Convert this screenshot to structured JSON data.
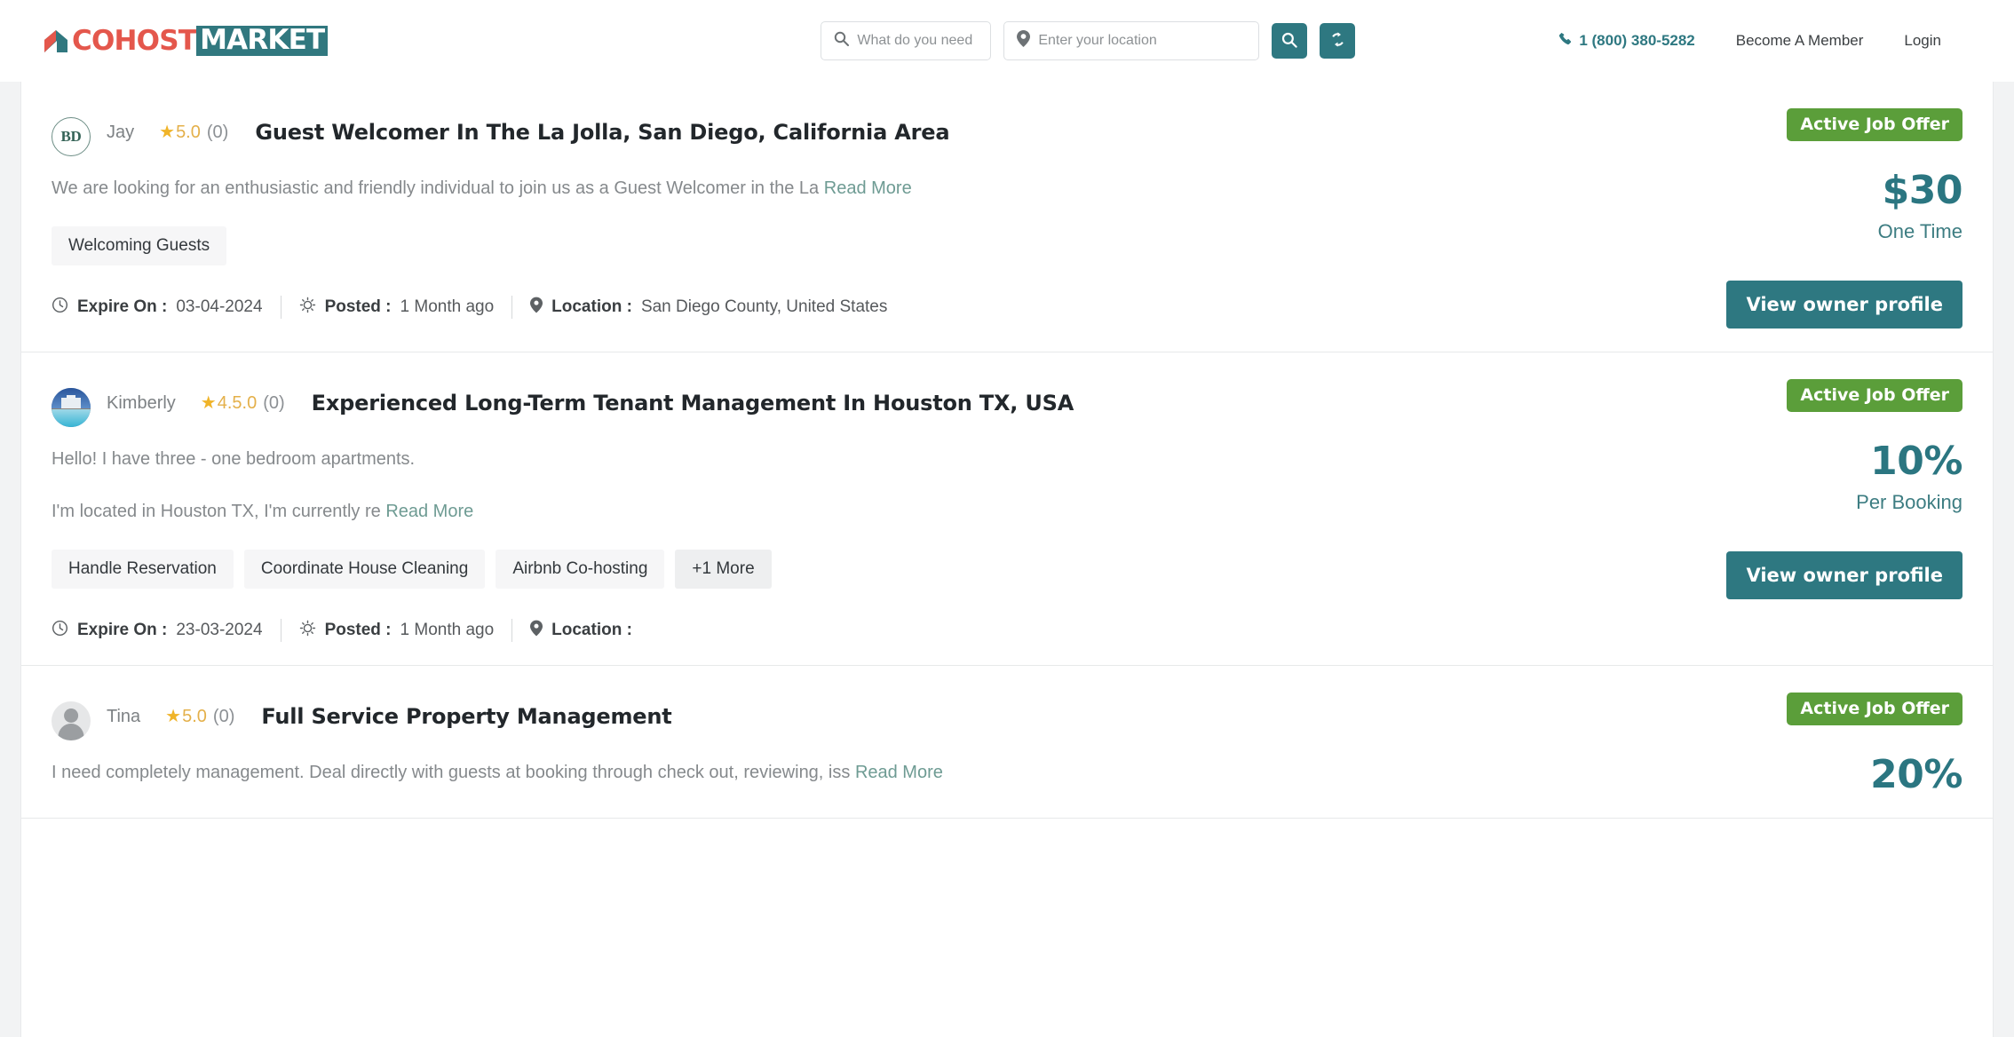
{
  "header": {
    "brand": {
      "word1": "COHOST",
      "word2": "MARKET",
      "arrow_icon": "home-arrow-icon"
    },
    "search": {
      "need_placeholder": "What do you need  ?",
      "need_value": "",
      "need_icon": "search-icon",
      "location_placeholder": "Enter your location",
      "location_value": "",
      "location_icon": "map-pin-icon",
      "search_button_icon": "search-icon",
      "reset_button_icon": "refresh-icon"
    },
    "phone": "1 (800) 380-5282",
    "phone_icon": "phone-icon",
    "become_member": "Become A Member",
    "login": "Login"
  },
  "labels": {
    "expire_on": "Expire On :",
    "posted": "Posted :",
    "location": "Location :",
    "read_more": "Read More",
    "view_owner_profile": "View owner profile",
    "clock_icon": "clock-icon",
    "gear_icon": "gear-icon",
    "pin_icon": "map-pin-icon",
    "star_icon": "star-icon"
  },
  "colors": {
    "brand_red": "#e4574c",
    "brand_teal": "#31787f",
    "accent_teal": "#2e7881",
    "badge_green": "#5b9e3a",
    "price_teal": "#2b7681",
    "star_gold": "#f0b429"
  },
  "jobs": [
    {
      "avatar_type": "monogram",
      "avatar_text": "BD",
      "owner": "Jay",
      "rating": "5.0",
      "reviews": "(0)",
      "title": "Guest Welcomer In The La Jolla, San Diego, California Area",
      "descriptions": [
        "We are looking for an enthusiastic and friendly individual to join us as a Guest Welcomer in the La"
      ],
      "tags": [
        "Welcoming Guests"
      ],
      "more_tag": "",
      "expire_on": "03-04-2024",
      "posted": "1 Month ago",
      "location": "San Diego County, United States",
      "status": "Active Job Offer",
      "price": "$30",
      "price_unit": "One Time",
      "button": "View owner profile"
    },
    {
      "avatar_type": "photo",
      "avatar_text": "",
      "owner": "Kimberly",
      "rating": "4.5.0",
      "reviews": "(0)",
      "title": "Experienced Long-Term Tenant Management In Houston TX, USA",
      "descriptions": [
        "Hello! I have three - one bedroom apartments.",
        "I'm located in Houston TX, I'm currently re"
      ],
      "tags": [
        "Handle Reservation",
        "Coordinate House Cleaning",
        "Airbnb Co-hosting"
      ],
      "more_tag": "+1 More",
      "expire_on": "23-03-2024",
      "posted": "1 Month ago",
      "location": "",
      "status": "Active Job Offer",
      "price": "10%",
      "price_unit": "Per Booking",
      "button": "View owner profile"
    },
    {
      "avatar_type": "blank",
      "avatar_text": "",
      "owner": "Tina",
      "rating": "5.0",
      "reviews": "(0)",
      "title": "Full Service Property Management",
      "descriptions": [
        "I need completely management. Deal directly with guests at booking through check out, reviewing, iss"
      ],
      "tags": [],
      "more_tag": "",
      "expire_on": "",
      "posted": "",
      "location": "",
      "status": "Active Job Offer",
      "price": "20%",
      "price_unit": "",
      "button": ""
    }
  ]
}
